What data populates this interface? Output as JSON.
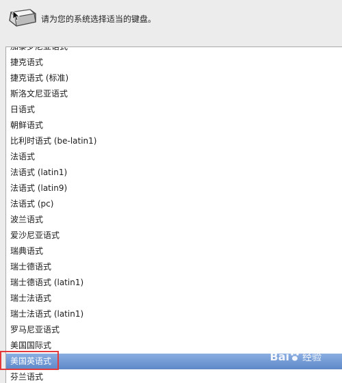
{
  "header": {
    "prompt": "请为您的系统选择适当的键盘。",
    "icon": "keyboard-icon"
  },
  "keyboard_list": {
    "items": [
      "加泰罗尼亚语式",
      "捷克语式",
      "捷克语式 (标准)",
      "斯洛文尼亚语式",
      "日语式",
      "朝鲜语式",
      "比利时语式 (be-latin1)",
      "法语式",
      "法语式 (latin1)",
      "法语式 (latin9)",
      "法语式 (pc)",
      "波兰语式",
      "爱沙尼亚语式",
      "瑞典语式",
      "瑞士德语式",
      "瑞士德语式 (latin1)",
      "瑞士法语式",
      "瑞士法语式 (latin1)",
      "罗马尼亚语式",
      "美国国际式",
      "美国英语式",
      "芬兰语式"
    ],
    "selected": "美国英语式"
  },
  "watermark": {
    "brand_left": "Bai",
    "brand_right": "经验"
  },
  "colors": {
    "selection": "#6f97d4",
    "highlight_border": "#e23a3a"
  }
}
